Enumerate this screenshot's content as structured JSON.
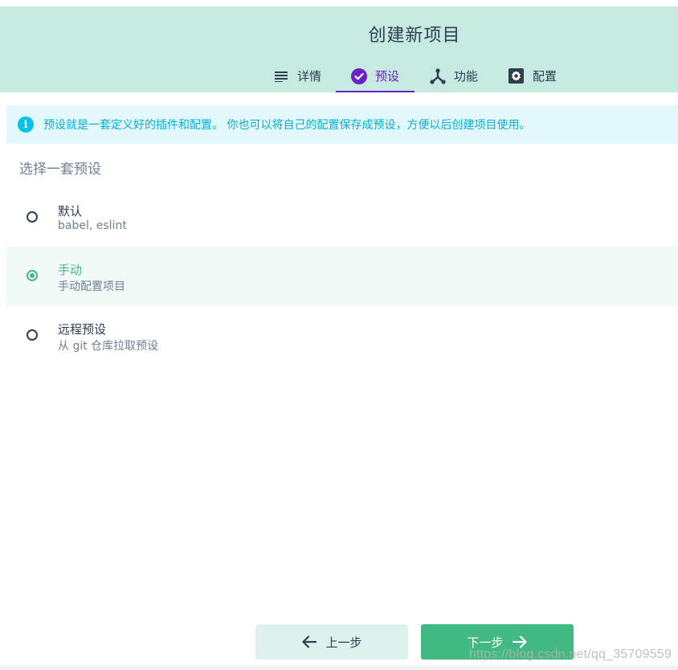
{
  "header": {
    "title": "创建新项目",
    "tabs": [
      {
        "label": "详情",
        "icon": "list-icon",
        "active": false
      },
      {
        "label": "预设",
        "icon": "check-circle-icon",
        "active": true
      },
      {
        "label": "功能",
        "icon": "merge-icon",
        "active": false
      },
      {
        "label": "配置",
        "icon": "settings-icon",
        "active": false
      }
    ]
  },
  "info": {
    "icon": "info-icon",
    "text": "预设就是一套定义好的插件和配置。 你也可以将自己的配置保存成预设，方便以后创建项目使用。"
  },
  "section": {
    "title": "选择一套预设"
  },
  "presets": [
    {
      "name": "默认",
      "description": "babel, eslint",
      "selected": false
    },
    {
      "name": "手动",
      "description": "手动配置项目",
      "selected": true
    },
    {
      "name": "远程预设",
      "description": "从 git 仓库拉取预设",
      "selected": false
    }
  ],
  "footer": {
    "prev_label": "上一步",
    "next_label": "下一步"
  },
  "watermark": "https://blog.csdn.net/qq_35709559",
  "colors": {
    "header_bg": "#c7eae0",
    "accent_purple": "#6a1fc7",
    "accent_green": "#42b983",
    "info_blue": "#03c2e6"
  }
}
